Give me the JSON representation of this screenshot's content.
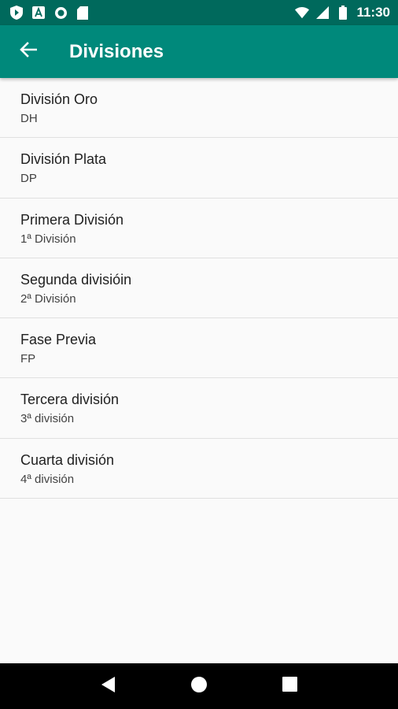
{
  "status_bar": {
    "time": "11:30",
    "left_icons": [
      "shield-play-icon",
      "notification-a-icon",
      "circle-icon",
      "sd-card-icon"
    ],
    "right_icons": [
      "wifi-icon",
      "signal-icon",
      "battery-icon"
    ]
  },
  "app_bar": {
    "title": "Divisiones",
    "back_icon": "arrow-back-icon",
    "color": "#00897b"
  },
  "divisions": [
    {
      "name": "División Oro",
      "code": "DH"
    },
    {
      "name": "División Plata",
      "code": "DP"
    },
    {
      "name": "Primera División",
      "code": "1ª División"
    },
    {
      "name": "Segunda divisióin",
      "code": "2ª División"
    },
    {
      "name": "Fase Previa",
      "code": "FP"
    },
    {
      "name": "Tercera división",
      "code": "3ª división"
    },
    {
      "name": "Cuarta división",
      "code": "4ª división"
    }
  ],
  "nav_bar": {
    "icons": [
      "back-triangle-icon",
      "home-circle-icon",
      "recents-square-icon"
    ]
  }
}
